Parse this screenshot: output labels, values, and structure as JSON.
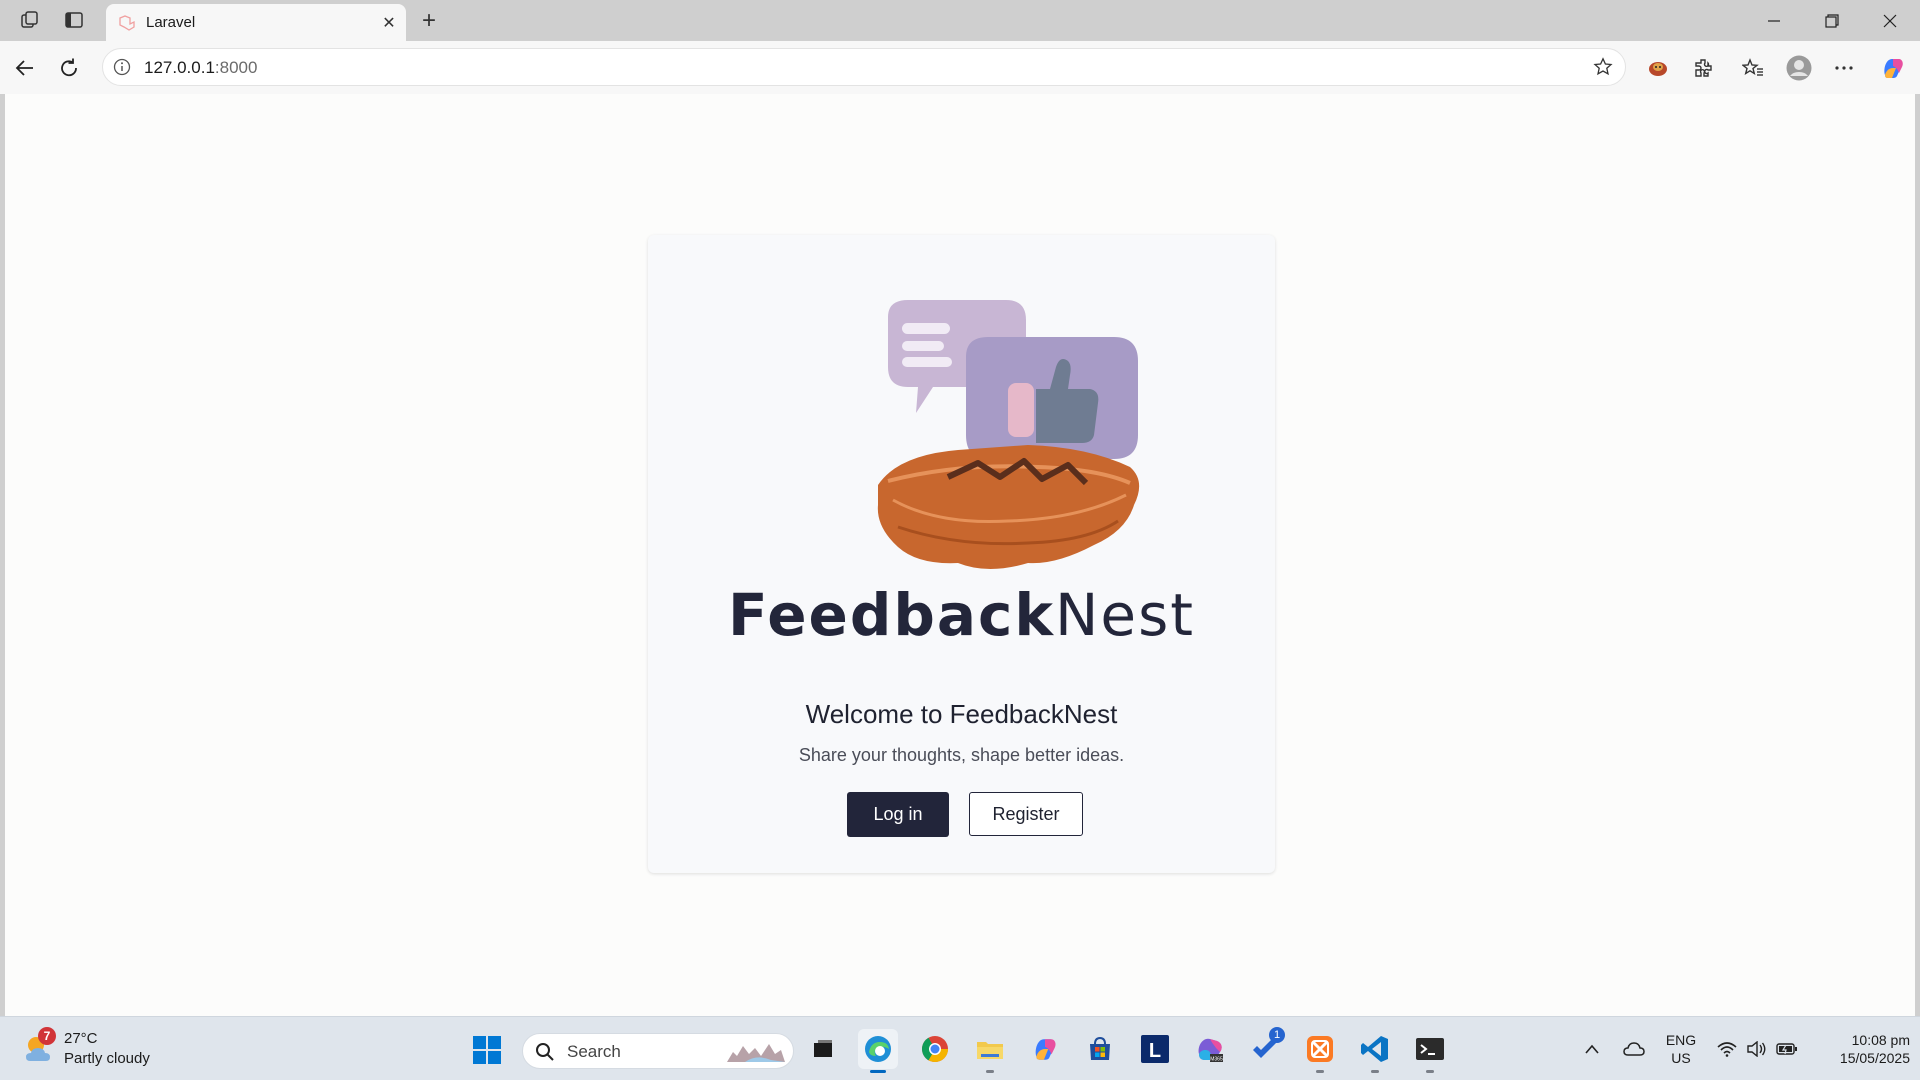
{
  "browser": {
    "tab": {
      "title": "Laravel"
    },
    "address": {
      "host": "127.0.0.1",
      "port": ":8000"
    }
  },
  "page": {
    "brand": {
      "bold": "Feedback",
      "light": "Nest"
    },
    "welcome_heading": "Welcome to FeedbackNest",
    "tagline": "Share your thoughts, shape better ideas.",
    "login_label": "Log in",
    "register_label": "Register"
  },
  "taskbar": {
    "weather": {
      "badge": "7",
      "temperature": "27°C",
      "description": "Partly cloudy"
    },
    "search_placeholder": "Search",
    "apps": [
      {
        "name": "task-view-icon"
      },
      {
        "name": "edge-icon"
      },
      {
        "name": "chrome-icon"
      },
      {
        "name": "file-explorer-icon"
      },
      {
        "name": "copilot-icon"
      },
      {
        "name": "store-icon"
      },
      {
        "name": "l-app-icon",
        "letter": "L"
      },
      {
        "name": "m365-icon"
      },
      {
        "name": "todo-icon",
        "badge": "1"
      },
      {
        "name": "xampp-icon"
      },
      {
        "name": "vscode-icon"
      },
      {
        "name": "terminal-icon"
      }
    ],
    "lang": {
      "line1": "ENG",
      "line2": "US"
    },
    "clock": {
      "time": "10:08 pm",
      "date": "15/05/2025"
    }
  },
  "colors": {
    "brand_text": "#23263a",
    "nest_orange": "#c8672e",
    "bubble_lilac": "#c8b6d4",
    "bubble_purple": "#a79bc6",
    "login_bg": "#22253a"
  }
}
